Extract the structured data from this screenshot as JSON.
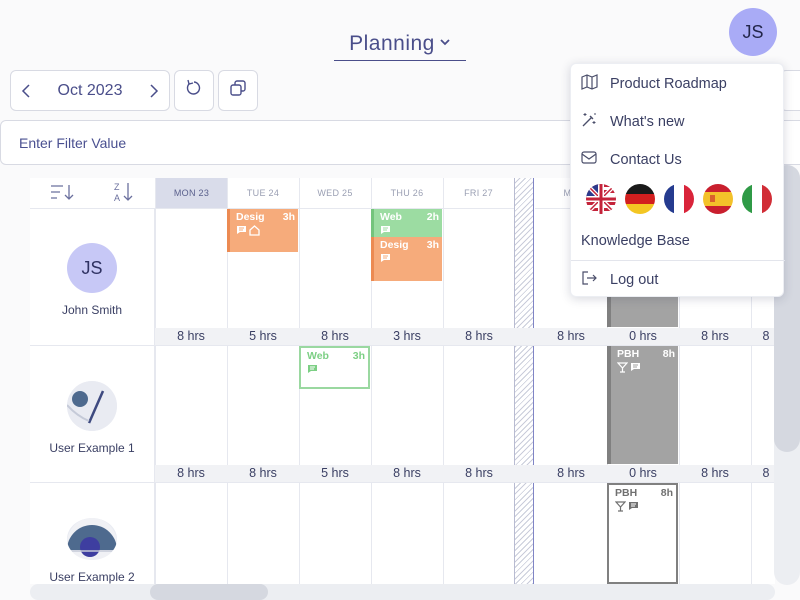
{
  "header": {
    "title": "Planning",
    "user_initials": "JS"
  },
  "toolbar": {
    "month": "Oct 2023"
  },
  "filter": {
    "placeholder": "Enter Filter Value"
  },
  "days": [
    "MON 23",
    "TUE 24",
    "WED 25",
    "THU 26",
    "FRI 27",
    "MO"
  ],
  "users": [
    {
      "initials": "JS",
      "name": "John Smith",
      "totals": [
        "8 hrs",
        "5 hrs",
        "8 hrs",
        "3 hrs",
        "8 hrs",
        "8 hrs",
        "0 hrs",
        "8 hrs",
        "8"
      ]
    },
    {
      "name": "User Example 1",
      "totals": [
        "8 hrs",
        "8 hrs",
        "5 hrs",
        "8 hrs",
        "8 hrs",
        "8 hrs",
        "0 hrs",
        "8 hrs",
        "8"
      ]
    },
    {
      "name": "User Example 2"
    }
  ],
  "events": {
    "e1": {
      "name": "Desig",
      "hours": "3h"
    },
    "e2": {
      "name": "Web",
      "hours": "2h"
    },
    "e3": {
      "name": "Desig",
      "hours": "3h"
    },
    "e4": {
      "name": "Web",
      "hours": "3h"
    },
    "e5": {
      "name": "PBH",
      "hours": "8h"
    },
    "e6": {
      "name": "PBH",
      "hours": "8h"
    }
  },
  "menu": {
    "roadmap": "Product Roadmap",
    "whats_new": "What's new",
    "contact": "Contact Us",
    "knowledge_base": "Knowledge Base",
    "logout": "Log out",
    "languages": [
      "English",
      "German",
      "French",
      "Spanish",
      "Italian"
    ]
  },
  "colors": {
    "accent": "#4a4e8a",
    "avatar": "#a9abf6",
    "event_orange": "#f6ab7b",
    "event_green": "#9cdca2",
    "event_gray": "#a3a3a3"
  }
}
